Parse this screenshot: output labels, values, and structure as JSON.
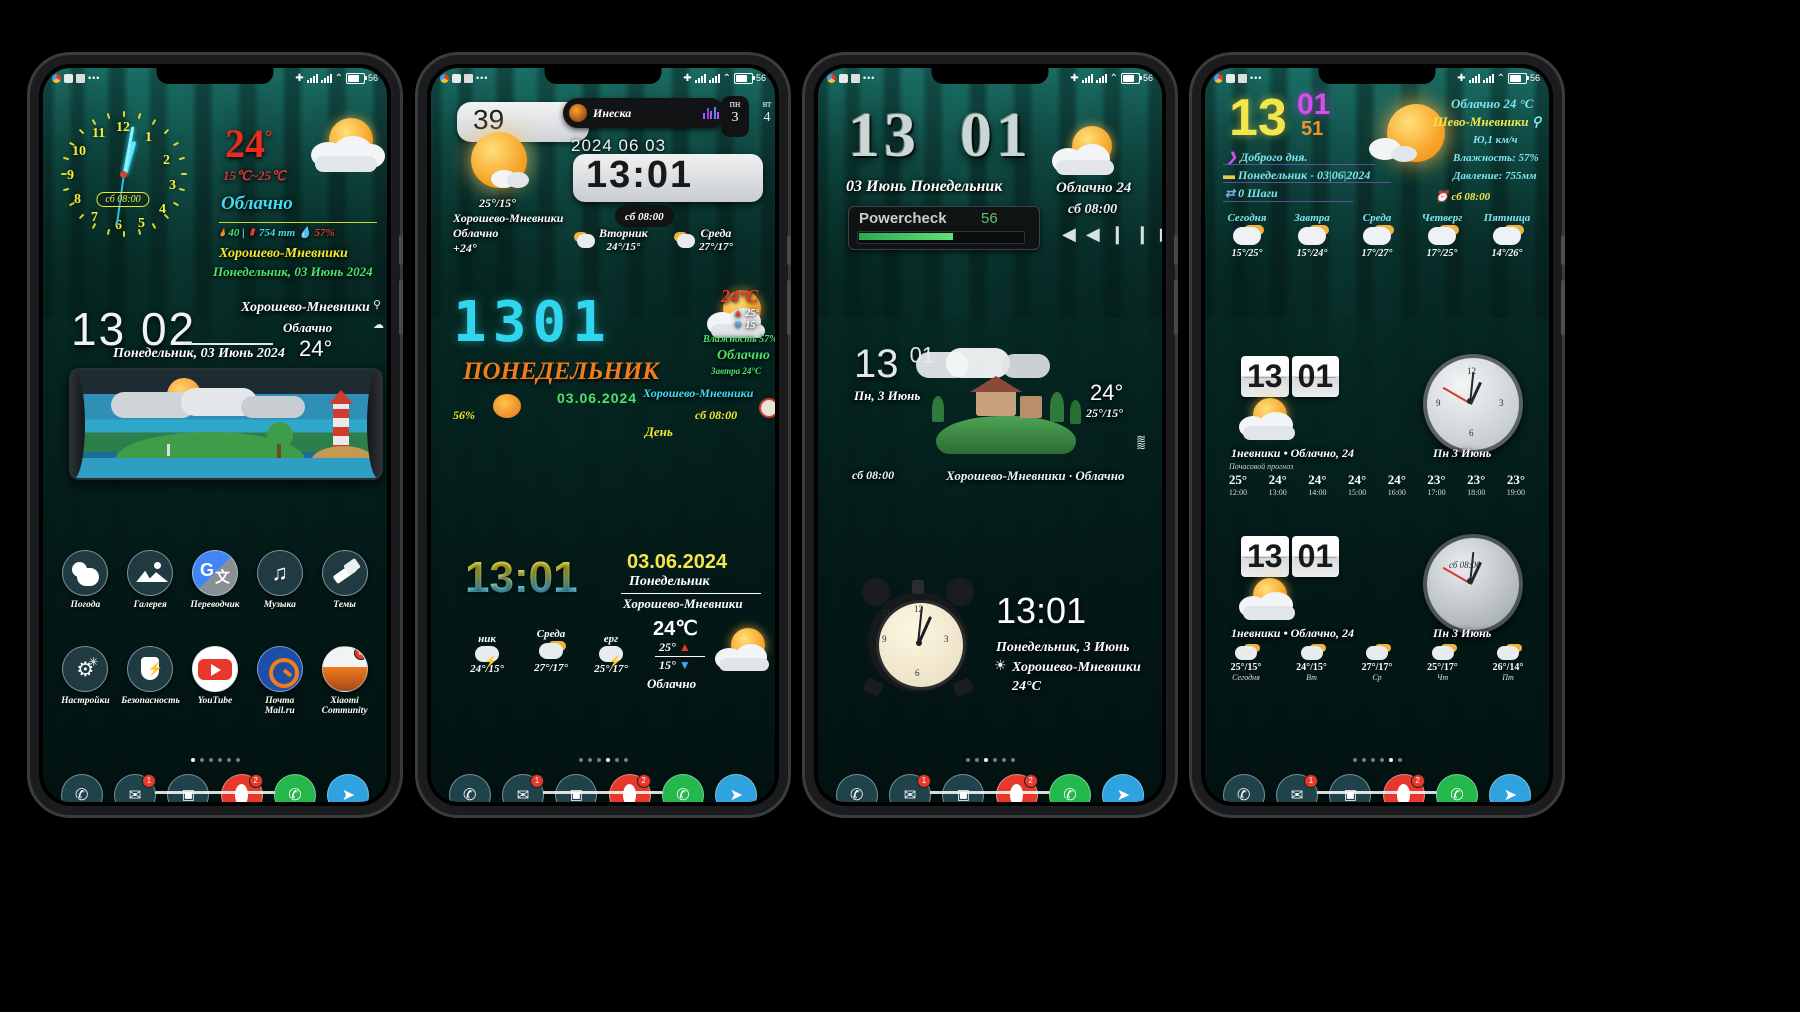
{
  "meta": {
    "scene": "Four Android phone home screens with weather/clock widget themes, forest wallpaper",
    "wallpaper": "dark green pine forest with teal sky"
  },
  "status_bar": {
    "battery_percent": "56",
    "icons_left": [
      "chrome-icon",
      "battery-saver-icon",
      "mail-icon",
      "more-dots-icon"
    ],
    "icons_right": [
      "bluetooth-icon",
      "signal-sim1-icon",
      "signal-sim2-icon",
      "wifi-icon",
      "battery-icon"
    ]
  },
  "common": {
    "location": "Хорошево-Мневники",
    "condition": "Облачно",
    "temp_c": "24°",
    "alarm": "сб 08:00",
    "date_full": "Понедельник, 03 Июнь 2024",
    "date_numeric": "03.06.2024"
  },
  "phone1": {
    "analog_clock": {
      "numbers": [
        "12",
        "1",
        "2",
        "3",
        "4",
        "5",
        "6",
        "7",
        "8",
        "9",
        "10",
        "11"
      ],
      "alarm_label": "сб 08:00",
      "hour": 13,
      "minute": 2
    },
    "weather": {
      "temp": "24",
      "degree": "°",
      "range": "15℃~25℃",
      "condition": "Облачно",
      "wind": "40",
      "pressure": "754 mm",
      "humidity": "57%",
      "location": "Хорошево-Мневники",
      "date": "Понедельник, 03 Июнь 2024",
      "icon": "sun-behind-cloud-icon"
    },
    "clock_widget": {
      "hours": "13",
      "minutes": "02",
      "date": "Понедельник, 03 Июнь 2024",
      "location": "Хорошево-Мневники",
      "condition": "Облачно",
      "temp": "24°"
    },
    "scene_widget": {
      "name": "lighthouse-island-weather-scene"
    },
    "apps_row1": [
      {
        "label": "Погода",
        "icon": "cloud-sun-icon"
      },
      {
        "label": "Галерея",
        "icon": "gallery-mountain-icon"
      },
      {
        "label": "Переводчик",
        "icon": "google-translate-icon"
      },
      {
        "label": "Музыка",
        "icon": "music-note-icon"
      },
      {
        "label": "Темы",
        "icon": "themes-brush-icon"
      }
    ],
    "apps_row2": [
      {
        "label": "Настройки",
        "icon": "settings-gear-icon",
        "badge": ""
      },
      {
        "label": "Безопасность",
        "icon": "shield-bolt-icon",
        "badge": ""
      },
      {
        "label": "YouTube",
        "icon": "youtube-icon",
        "badge": ""
      },
      {
        "label": "Почта Mail.ru",
        "icon": "mail-ru-icon",
        "badge": ""
      },
      {
        "label": "Xiaomi Community",
        "icon": "xiaomi-community-icon",
        "badge": "8"
      }
    ],
    "page_dots": 6,
    "page_active": 0,
    "dock": [
      {
        "name": "phone-icon",
        "badge": ""
      },
      {
        "name": "sms-icon",
        "badge": "1"
      },
      {
        "name": "camera-icon",
        "badge": ""
      },
      {
        "name": "opera-icon",
        "badge": "2"
      },
      {
        "name": "whatsapp-icon",
        "badge": ""
      },
      {
        "name": "telegram-icon",
        "badge": ""
      }
    ]
  },
  "phone2": {
    "music_chip": {
      "title": "Инеска",
      "icon": "album-art-icon",
      "eq": "equalizer-icon"
    },
    "weather_big": {
      "value": "39",
      "range": "25°/15°",
      "location": "Хорошево-Мневники",
      "condition": "Облачно",
      "temp": "+24°",
      "icon": "sun-cloud-icon"
    },
    "date_row": "2024  06  03",
    "digital": {
      "time": "13:01",
      "alarm": "сб 08:00"
    },
    "calendar_chips": [
      {
        "dow": "пн",
        "num": "3"
      },
      {
        "dow": "вт",
        "num": "4"
      }
    ],
    "forecast_top": [
      {
        "day": "Вторник",
        "temp": "24°/15°",
        "icon": "sun-cloud-icon"
      },
      {
        "day": "Среда",
        "temp": "27°/17°",
        "icon": "sun-cloud-icon"
      }
    ],
    "lcd": {
      "time": "1301",
      "weekday": "ПОНЕДЕЛЬНИК",
      "date": "03.06.2024",
      "alarm": "сб 08:00",
      "part_of_day": "День",
      "battery": "56%"
    },
    "side_panel": {
      "temp": "24°C",
      "hi": "25°",
      "lo": "15°",
      "humidity": "Влажность 57%",
      "condition": "Облачно",
      "tomorrow": "Завтра 24°C",
      "location": "Хорошево-Мневники"
    },
    "bottom_widget": {
      "time": "13:01",
      "date": "03.06.2024",
      "weekday": "Понедельник",
      "location": "Хорошево-Мневники",
      "temp": "24℃",
      "hi": "25°",
      "lo": "15°",
      "condition": "Облачно",
      "forecast": [
        {
          "day": "ник",
          "temp": "24°/15°",
          "icon": "storm-icon"
        },
        {
          "day": "Среда",
          "temp": "27°/17°",
          "icon": "sun-cloud-icon"
        },
        {
          "day": "ерг",
          "temp": "25°/17°",
          "icon": "storm-icon"
        }
      ]
    },
    "page_dots": 6,
    "page_active": 3
  },
  "phone3": {
    "top_clock": {
      "hours": "13",
      "minutes": "01",
      "date": "03 Июнь Понедельник"
    },
    "powercheck": {
      "label": "Powercheck",
      "value": "56"
    },
    "weather_right": {
      "condition": "Облачно 24",
      "alarm": "сб 08:00",
      "controls": [
        "prev-icon",
        "pause-icon",
        "next-icon"
      ]
    },
    "mid_clock": {
      "hours": "13",
      "minutes": "01",
      "date": "Пн, 3 Июнь",
      "temp": "24°",
      "range": "25°/15°",
      "alarm": "сб 08:00",
      "caption": "Хорошево-Мневники · Облачно"
    },
    "alarm_widget": {
      "time": "13:01",
      "date": "Понедельник, 3 Июнь",
      "location": "Хорошево-Мневники",
      "temp": "24°C",
      "icon": "alarm-clock-icon"
    },
    "page_dots": 6,
    "page_active": 2
  },
  "phone4": {
    "top": {
      "hours": "13",
      "minutes": "01",
      "seconds": "51",
      "greeting": "Доброго дня.",
      "date_line": "Понедельник - 03|06|2024",
      "steps": "0 Шаги",
      "condition_line": "Облачно  24 °С",
      "location": "Шево-Мневники",
      "wind": "Ю,1 км/ч",
      "humidity": "Влажность: 57%",
      "pressure": "Давление: 755мм"
    },
    "forecast_strip": [
      {
        "day": "Сегодня",
        "temp": "15°/25°",
        "icon": "sun-cloud-icon"
      },
      {
        "day": "Завтра",
        "temp": "15°/24°",
        "icon": "sun-cloud-icon"
      },
      {
        "day": "Среда",
        "temp": "17°/27°",
        "icon": "sun-cloud-icon"
      },
      {
        "day": "Четверг",
        "temp": "17°/25°",
        "icon": "sun-cloud-icon"
      },
      {
        "day": "Пятница",
        "temp": "14°/26°",
        "icon": "sun-cloud-icon"
      }
    ],
    "widget_a": {
      "time": "13 01",
      "caption": "1невники • Облачно, 24",
      "analog_caption": "Пн 3 Июнь",
      "hourly_title": "Почасовой прогноз",
      "hourly": [
        {
          "temp": "25°",
          "time": "12:00"
        },
        {
          "temp": "24°",
          "time": "13:00"
        },
        {
          "temp": "24°",
          "time": "14:00"
        },
        {
          "temp": "24°",
          "time": "15:00"
        },
        {
          "temp": "24°",
          "time": "16:00"
        },
        {
          "temp": "23°",
          "time": "17:00"
        },
        {
          "temp": "23°",
          "time": "18:00"
        },
        {
          "temp": "23°",
          "time": "19:00"
        }
      ]
    },
    "widget_b": {
      "time": "13 01",
      "caption": "1невники • Облачно, 24",
      "analog_caption": "Пн 3 Июнь",
      "analog_alarm": "сб 08:00",
      "daily": [
        {
          "temp": "25°/15°",
          "day": "Сегодня"
        },
        {
          "temp": "24°/15°",
          "day": "Вт"
        },
        {
          "temp": "27°/17°",
          "day": "Ср"
        },
        {
          "temp": "25°/17°",
          "day": "Чт"
        },
        {
          "temp": "26°/14°",
          "day": "Пт"
        }
      ]
    },
    "page_dots": 6,
    "page_active": 4
  },
  "colors": {
    "accent_yellow": "#f1e92e",
    "accent_cyan": "#3fd8ef",
    "accent_red": "#e8382b",
    "accent_green": "#4ee36a",
    "accent_orange": "#f7a52a",
    "teal_bg": "#0d3a36"
  }
}
